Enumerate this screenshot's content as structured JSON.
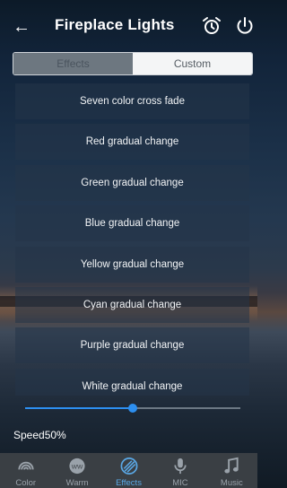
{
  "header": {
    "back_icon": "arrow-left-icon",
    "title": "Fireplace Lights",
    "alarm_icon": "alarm-clock-icon",
    "power_icon": "power-icon"
  },
  "tabs": [
    {
      "label": "Effects",
      "active": true
    },
    {
      "label": "Custom",
      "active": false
    }
  ],
  "effects": [
    "Seven color cross fade",
    "Red gradual change",
    "Green gradual change",
    "Blue gradual change",
    "Yellow gradual change",
    "Cyan gradual change",
    "Purple gradual change",
    "White gradual change"
  ],
  "speed": {
    "label": "Speed50%",
    "value_percent": 50
  },
  "bottom_nav": [
    {
      "label": "Color",
      "icon": "color-rainbow-icon",
      "active": false
    },
    {
      "label": "Warm",
      "icon": "warm-white-icon",
      "active": false
    },
    {
      "label": "Effects",
      "icon": "effects-icon",
      "active": true
    },
    {
      "label": "MIC",
      "icon": "microphone-icon",
      "active": false
    },
    {
      "label": "Music",
      "icon": "music-note-icon",
      "active": false
    }
  ],
  "colors": {
    "accent": "#2d8ff0",
    "nav_bg": "#3a3f44",
    "active_nav": "#5aa8e6"
  }
}
